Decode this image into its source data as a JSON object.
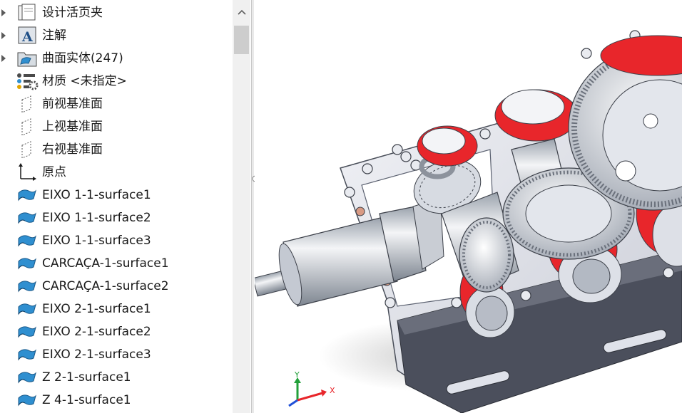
{
  "feature_tree": {
    "items": [
      {
        "label": "设计活页夹",
        "icon": "design-binder-icon",
        "expandable": true
      },
      {
        "label": "注解",
        "icon": "annotations-icon",
        "expandable": true
      },
      {
        "label": "曲面实体(247)",
        "icon": "surface-bodies-folder-icon",
        "expandable": true
      },
      {
        "label": "材质 <未指定>",
        "icon": "material-icon",
        "expandable": false
      },
      {
        "label": "前视基准面",
        "icon": "plane-icon",
        "expandable": false
      },
      {
        "label": "上视基准面",
        "icon": "plane-icon",
        "expandable": false
      },
      {
        "label": "右视基准面",
        "icon": "plane-icon",
        "expandable": false
      },
      {
        "label": "原点",
        "icon": "origin-icon",
        "expandable": false
      },
      {
        "label": "EIXO 1-1-surface1",
        "icon": "surface-feature-icon",
        "expandable": false
      },
      {
        "label": "EIXO 1-1-surface2",
        "icon": "surface-feature-icon",
        "expandable": false
      },
      {
        "label": "EIXO 1-1-surface3",
        "icon": "surface-feature-icon",
        "expandable": false
      },
      {
        "label": "CARCAÇA-1-surface1",
        "icon": "surface-feature-icon",
        "expandable": false
      },
      {
        "label": "CARCAÇA-1-surface2",
        "icon": "surface-feature-icon",
        "expandable": false
      },
      {
        "label": "EIXO 2-1-surface1",
        "icon": "surface-feature-icon",
        "expandable": false
      },
      {
        "label": "EIXO 2-1-surface2",
        "icon": "surface-feature-icon",
        "expandable": false
      },
      {
        "label": "EIXO 2-1-surface3",
        "icon": "surface-feature-icon",
        "expandable": false
      },
      {
        "label": "Z 2-1-surface1",
        "icon": "surface-feature-icon",
        "expandable": false
      },
      {
        "label": "Z 4-1-surface1",
        "icon": "surface-feature-icon",
        "expandable": false
      }
    ]
  },
  "triad": {
    "x_label": "X",
    "y_label": "Y"
  },
  "colors": {
    "accent_red": "#e8262b",
    "surface_icon": "#2f8fd0",
    "housing": "#e9ebf2"
  }
}
